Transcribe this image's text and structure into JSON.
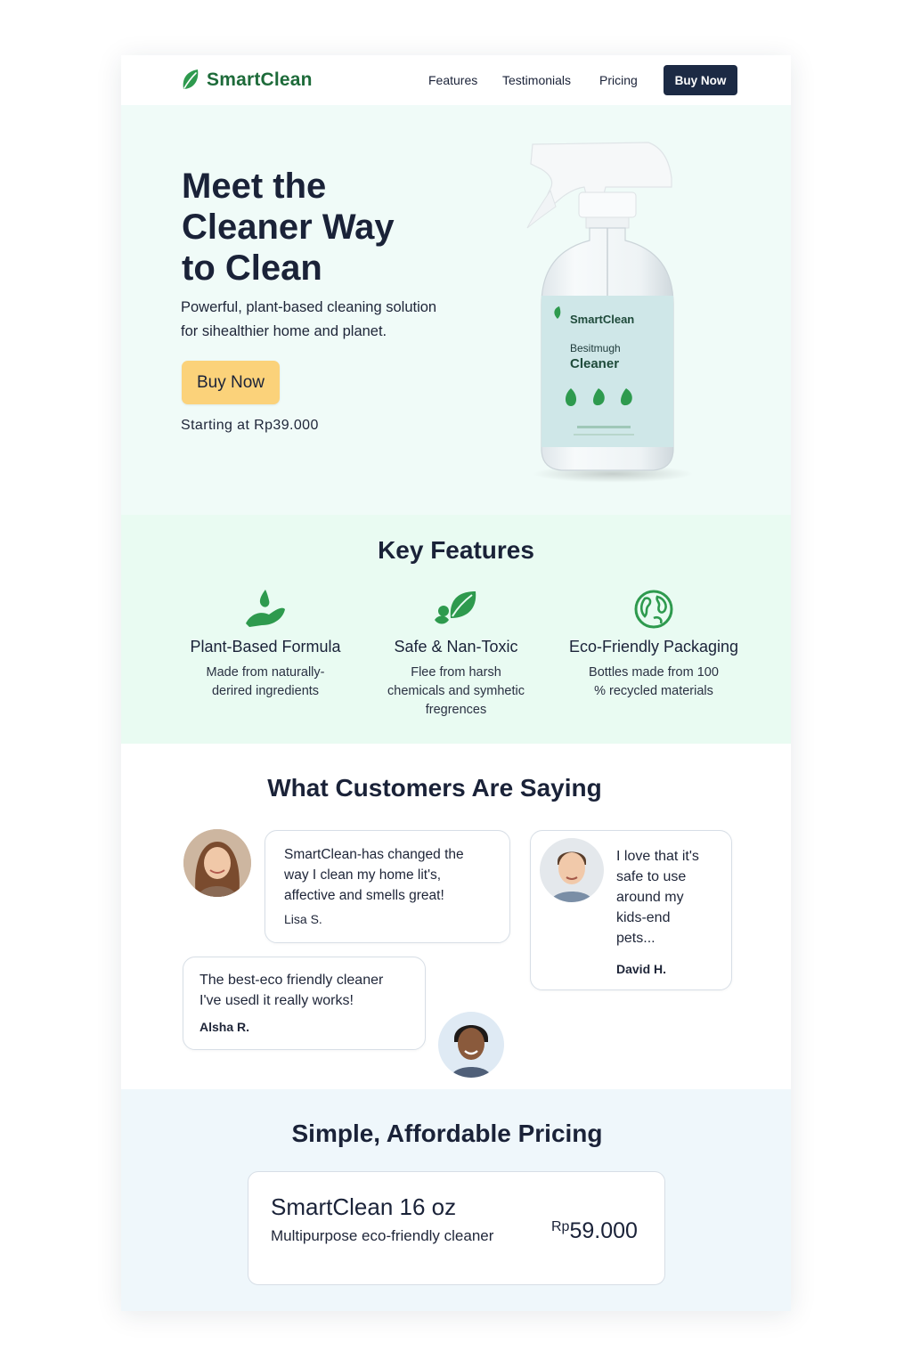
{
  "nav": {
    "brand": "SmartClean",
    "links": [
      "Features",
      "Testimonials",
      "Pricing"
    ],
    "cta": "Buy Now"
  },
  "hero": {
    "title_lines": [
      "Meet the",
      "Cleaner Way",
      "to Clean"
    ],
    "subtitle_lines": [
      "Powerful, plant-based cleaning solution",
      "for sihealthier home and planet."
    ],
    "cta": "Buy Now",
    "price_text": "Starting at Rp39.000",
    "bottle_label": {
      "brand": "SmartClean",
      "line1": "Besitmugh",
      "line2": "Cleaner"
    }
  },
  "features": {
    "title": "Key Features",
    "items": [
      {
        "icon": "hand-droplet-icon",
        "title": "Plant-Based Formula",
        "desc_lines": [
          "Made from naturally-",
          "derired ingredients"
        ]
      },
      {
        "icon": "leaves-icon",
        "title": "Safe & Nan-Toxic",
        "desc_lines": [
          "Flee from harsh",
          "chemicals and symhetic",
          "fregrences"
        ]
      },
      {
        "icon": "globe-icon",
        "title": "Eco-Friendly Packaging",
        "desc_lines": [
          "Bottles made from 100",
          "% recycled materials"
        ]
      }
    ]
  },
  "testimonials": {
    "title": "What Customers Are Saying",
    "items": [
      {
        "text_lines": [
          "SmartClean-has changed the",
          "way I clean my home lit's,",
          "affective and smells great!"
        ],
        "name": "Lisa S."
      },
      {
        "text_lines": [
          "I love that it's",
          "safe to use",
          "around my",
          "kids-end",
          "pets..."
        ],
        "name": "David H."
      },
      {
        "text_lines": [
          "The best-eco friendly cleaner",
          "I've usedl it really works!"
        ],
        "name": "Alsha R."
      }
    ]
  },
  "pricing": {
    "title": "Simple, Affordable Pricing",
    "product": "SmartClean 16 oz",
    "description": "Multipurpose eco-friendly cleaner",
    "currency": "Rp",
    "amount": "59.000"
  },
  "colors": {
    "accent_green": "#2e9a4e",
    "brand_green": "#1e6b3a",
    "navy": "#1c2a44",
    "cta_yellow": "#fbd27a",
    "hero_bg": "#f0fbf8",
    "features_bg": "#e9fbf2",
    "pricing_bg": "#eff7fb"
  }
}
